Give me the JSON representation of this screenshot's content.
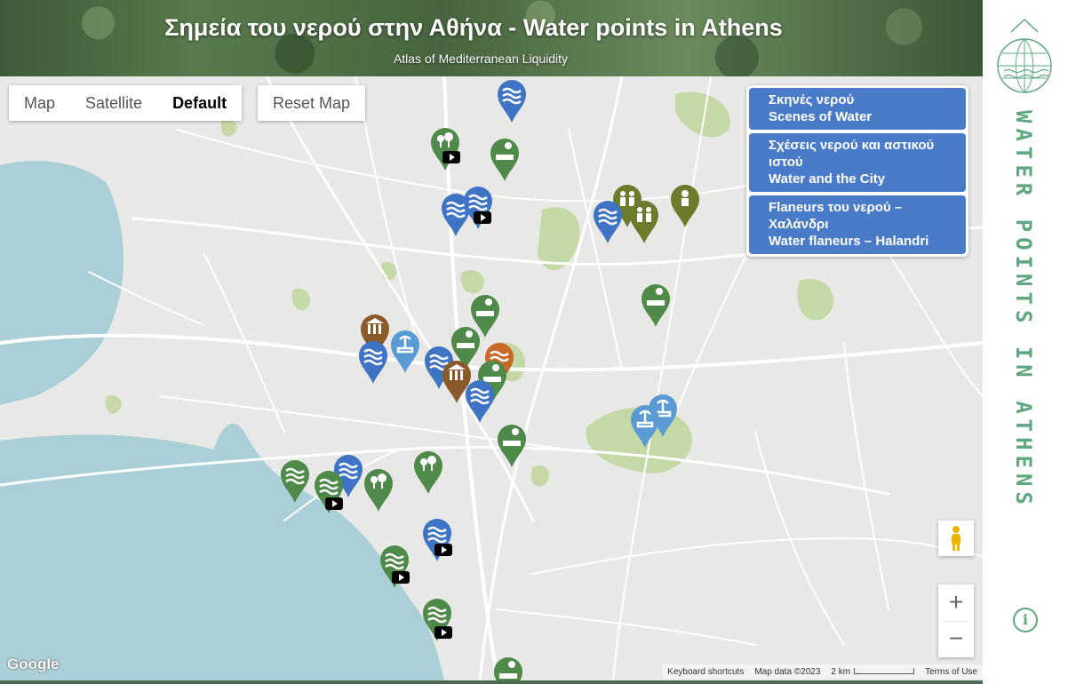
{
  "header": {
    "title": "Σημεία του νερού στην Αθήνα - Water points in Athens",
    "subtitle": "Atlas of Mediterranean Liquidity"
  },
  "map_controls": {
    "map_label": "Map",
    "satellite_label": "Satellite",
    "default_label": "Default",
    "reset_label": "Reset Map",
    "zoom_in": "+",
    "zoom_out": "−"
  },
  "layers": [
    {
      "line1": "Σκηνές νερού",
      "line2": "Scenes of Water",
      "color": "#4a7bc8"
    },
    {
      "line1": "Σχέσεις νερού και αστικού ιστού",
      "line2": "Water and the City",
      "color": "#4a7bc8"
    },
    {
      "line1": "Flaneurs του νερού – Χαλάνδρι",
      "line2": "Water flaneurs – Halandri",
      "color": "#4a7bc8"
    }
  ],
  "attribution": {
    "google": "Google",
    "shortcuts": "Keyboard shortcuts",
    "mapdata": "Map data ©2023",
    "scale": "2 km",
    "terms": "Terms of Use"
  },
  "sidebar": {
    "vertical_title": "WATER POINTS IN ATHENS",
    "info": "i"
  },
  "colors": {
    "blue_marker": "#3f74c4",
    "green_marker": "#4f8a4a",
    "olive_marker": "#6b7d2c",
    "brown_marker": "#8a5a2a",
    "light_blue_marker": "#5b9bd5",
    "orange_marker": "#c8692a",
    "sea": "#aacfd6",
    "land": "#e8e8e6",
    "park": "#c5d9a6",
    "accent": "#5ea87f"
  }
}
